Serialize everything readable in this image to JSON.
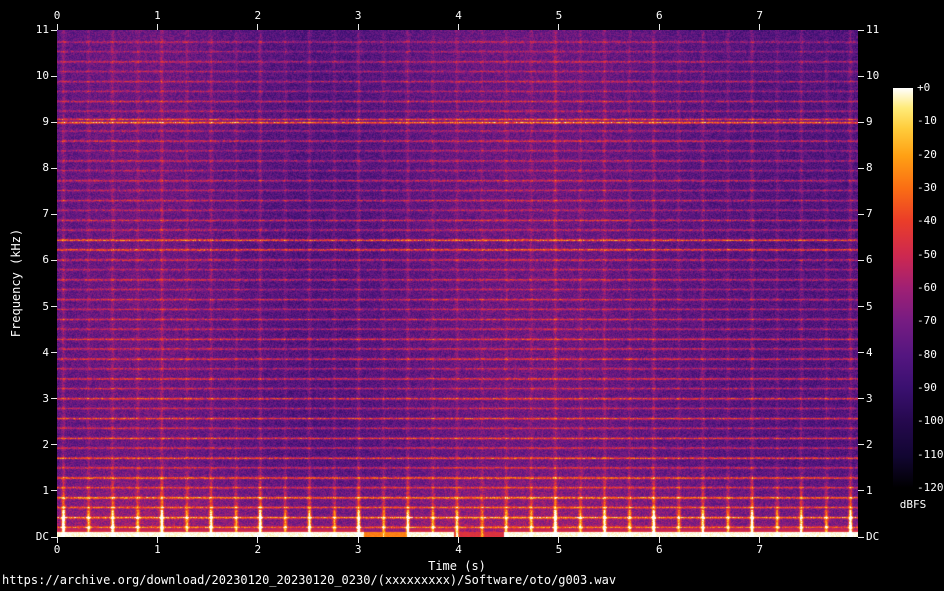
{
  "window": {
    "background": "#000000",
    "text_color": "#ffffff"
  },
  "chart_data": {
    "type": "heatmap",
    "subtype": "audio-spectrogram",
    "title": "https://archive.org/download/20230120_20230120_0230/(xxxxxxxxx)/Software/oto/g003.wav",
    "xlabel": "Time (s)",
    "ylabel": "Frequency (kHz)",
    "x_range_s": [
      0,
      7.98
    ],
    "x_ticks": [
      0,
      1,
      2,
      3,
      4,
      5,
      6,
      7
    ],
    "y_range_khz": [
      0,
      11
    ],
    "y_ticks": [
      {
        "label": "11",
        "khz": 11
      },
      {
        "label": "10",
        "khz": 10
      },
      {
        "label": "9",
        "khz": 9
      },
      {
        "label": "8",
        "khz": 8
      },
      {
        "label": "7",
        "khz": 7
      },
      {
        "label": "6",
        "khz": 6
      },
      {
        "label": "5",
        "khz": 5
      },
      {
        "label": "4",
        "khz": 4
      },
      {
        "label": "3",
        "khz": 3
      },
      {
        "label": "2",
        "khz": 2
      },
      {
        "label": "1",
        "khz": 1
      },
      {
        "label": "DC",
        "khz": 0
      }
    ],
    "colorbar": {
      "label": "dBFS",
      "ticks": [
        "+0",
        "-10",
        "-20",
        "-30",
        "-40",
        "-50",
        "-60",
        "-70",
        "-80",
        "-90",
        "-100",
        "-110",
        "-120"
      ],
      "min_dbfs": -120,
      "max_dbfs": 0
    },
    "palette": [
      {
        "pos": 0.0,
        "color": "#000000"
      },
      {
        "pos": 0.08,
        "color": "#120632"
      },
      {
        "pos": 0.17,
        "color": "#26094f"
      },
      {
        "pos": 0.25,
        "color": "#3a1070"
      },
      {
        "pos": 0.33,
        "color": "#541680"
      },
      {
        "pos": 0.42,
        "color": "#781c82"
      },
      {
        "pos": 0.5,
        "color": "#a02074"
      },
      {
        "pos": 0.58,
        "color": "#cd2850"
      },
      {
        "pos": 0.67,
        "color": "#eb3e28"
      },
      {
        "pos": 0.75,
        "color": "#fa6e14"
      },
      {
        "pos": 0.83,
        "color": "#ffa014"
      },
      {
        "pos": 0.9,
        "color": "#ffcd3c"
      },
      {
        "pos": 0.95,
        "color": "#ffeb78"
      },
      {
        "pos": 1.0,
        "color": "#ffffff"
      }
    ],
    "features": {
      "noise_floor": {
        "base": 0.27,
        "jitter": 0.17
      },
      "low_band_glow_khz": 1.7,
      "bass_band": {
        "bright_below_khz": 0.13,
        "fringe_below_khz": 0.32
      },
      "bass_dips": [
        {
          "from": 3.05,
          "to": 3.5,
          "level": 0.78
        },
        {
          "from": 3.95,
          "to": 4.45,
          "level": 0.62
        }
      ],
      "beats": [
        [
          0.06,
          1
        ],
        [
          0.31,
          0.6
        ],
        [
          0.55,
          0.85
        ],
        [
          0.8,
          0.6
        ],
        [
          1.04,
          1
        ],
        [
          1.29,
          0.6
        ],
        [
          1.53,
          0.85
        ],
        [
          1.78,
          0.6
        ],
        [
          2.02,
          1
        ],
        [
          2.27,
          0.6
        ],
        [
          2.51,
          0.85
        ],
        [
          2.76,
          0.6
        ],
        [
          3.0,
          1
        ],
        [
          3.25,
          0.6
        ],
        [
          3.49,
          0.85
        ],
        [
          3.74,
          0.6
        ],
        [
          3.98,
          0.7
        ],
        [
          4.23,
          0.45
        ],
        [
          4.47,
          0.6
        ],
        [
          4.72,
          0.6
        ],
        [
          4.96,
          1
        ],
        [
          5.21,
          0.6
        ],
        [
          5.45,
          0.85
        ],
        [
          5.7,
          0.6
        ],
        [
          5.94,
          1
        ],
        [
          6.19,
          0.6
        ],
        [
          6.43,
          0.85
        ],
        [
          6.68,
          0.6
        ],
        [
          6.92,
          1
        ],
        [
          7.17,
          0.6
        ],
        [
          7.41,
          0.85
        ],
        [
          7.66,
          0.6
        ],
        [
          7.9,
          1
        ]
      ],
      "harmonic_lines": [
        [
          0.22,
          0.4
        ],
        [
          0.43,
          0.5
        ],
        [
          0.65,
          0.38
        ],
        [
          0.86,
          0.5
        ],
        [
          1.08,
          0.32
        ],
        [
          1.29,
          0.45
        ],
        [
          1.51,
          0.3
        ],
        [
          1.72,
          0.45
        ],
        [
          1.94,
          0.3
        ],
        [
          2.15,
          0.4
        ],
        [
          2.37,
          0.28
        ],
        [
          2.58,
          0.4
        ],
        [
          2.8,
          0.26
        ],
        [
          3.01,
          0.4
        ],
        [
          3.23,
          0.26
        ],
        [
          3.44,
          0.35
        ],
        [
          3.66,
          0.25
        ],
        [
          3.87,
          0.35
        ],
        [
          4.09,
          0.28
        ],
        [
          4.3,
          0.35
        ],
        [
          4.52,
          0.25
        ],
        [
          4.73,
          0.3
        ],
        [
          4.95,
          0.25
        ],
        [
          5.16,
          0.3
        ],
        [
          5.38,
          0.22
        ],
        [
          5.59,
          0.3
        ],
        [
          5.81,
          0.22
        ],
        [
          6.02,
          0.3
        ],
        [
          6.24,
          0.45
        ],
        [
          6.45,
          0.5
        ],
        [
          6.67,
          0.25
        ],
        [
          6.88,
          0.3
        ],
        [
          7.1,
          0.22
        ],
        [
          7.31,
          0.28
        ],
        [
          7.53,
          0.22
        ],
        [
          7.74,
          0.28
        ],
        [
          7.96,
          0.2
        ],
        [
          8.17,
          0.25
        ],
        [
          8.39,
          0.2
        ],
        [
          8.6,
          0.3
        ],
        [
          8.82,
          0.2
        ],
        [
          9.0,
          0.55
        ],
        [
          9.07,
          0.4
        ],
        [
          9.25,
          0.2
        ],
        [
          9.46,
          0.28
        ],
        [
          9.68,
          0.2
        ],
        [
          9.89,
          0.25
        ],
        [
          10.11,
          0.2
        ],
        [
          10.32,
          0.25
        ],
        [
          10.54,
          0.18
        ],
        [
          10.75,
          0.22
        ]
      ]
    }
  }
}
